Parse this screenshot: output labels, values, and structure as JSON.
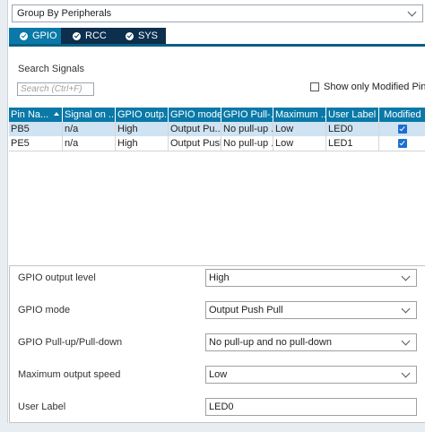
{
  "group_by": {
    "value": "Group By Peripherals"
  },
  "tabs": [
    {
      "label": "GPIO",
      "active": true
    },
    {
      "label": "RCC",
      "active": false
    },
    {
      "label": "SYS",
      "active": false
    }
  ],
  "search": {
    "title": "Search Signals",
    "placeholder": "Search (Ctrl+F)",
    "show_modified_label": "Show only Modified Pins",
    "show_modified_checked": false
  },
  "table": {
    "headers": [
      "Pin Na...",
      "Signal on ...",
      "GPIO outp...",
      "GPIO mode",
      "GPIO Pull-...",
      "Maximum ...",
      "User Label",
      "Modified"
    ],
    "sorted_column": 0,
    "rows": [
      {
        "cells": [
          "PB5",
          "n/a",
          "High",
          "Output Pu...",
          "No pull-up ...",
          "Low",
          "LED0"
        ],
        "modified": true,
        "selected": true
      },
      {
        "cells": [
          "PE5",
          "n/a",
          "High",
          "Output Push...",
          "No pull-up ...",
          "Low",
          "LED1"
        ],
        "modified": true,
        "selected": false
      }
    ]
  },
  "config": {
    "output_level": {
      "label": "GPIO output level",
      "value": "High"
    },
    "mode": {
      "label": "GPIO mode",
      "value": "Output Push Pull"
    },
    "pull": {
      "label": "GPIO Pull-up/Pull-down",
      "value": "No pull-up and no pull-down"
    },
    "speed": {
      "label": "Maximum output speed",
      "value": "Low"
    },
    "user_label": {
      "label": "User Label",
      "value": "LED0"
    }
  },
  "colors": {
    "tab_active": "#0a79a8",
    "tab_inactive": "#0b2f4d",
    "header_bg": "#0a79a8",
    "selected_row": "#cfe3f2"
  }
}
